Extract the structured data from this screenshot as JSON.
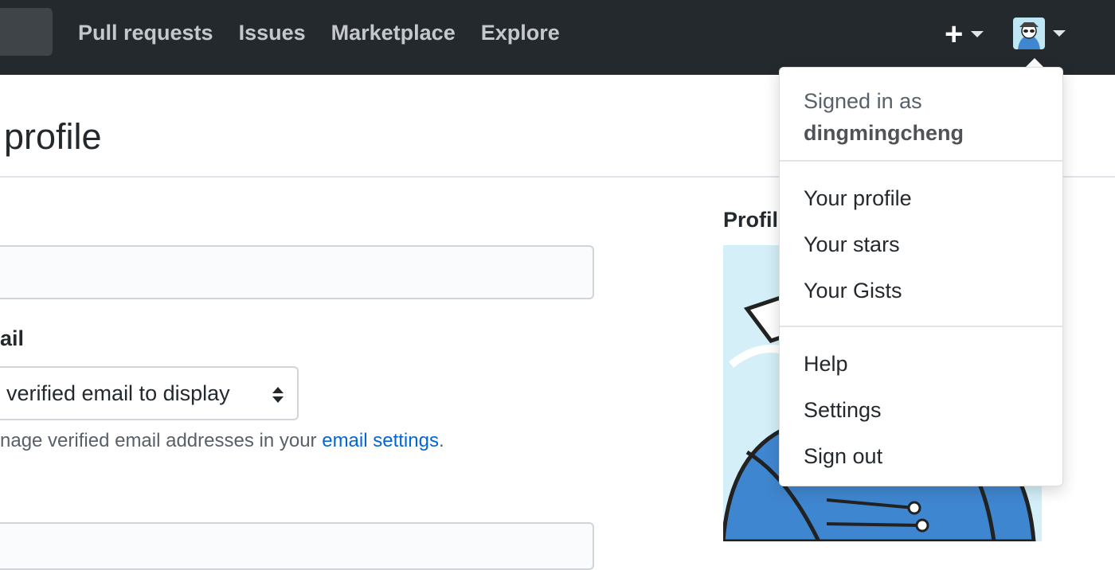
{
  "header": {
    "nav": [
      "Pull requests",
      "Issues",
      "Marketplace",
      "Explore"
    ],
    "plus_icon": "plus-icon",
    "caret_icon": "caret-down-icon"
  },
  "main": {
    "page_title": "profile",
    "email_label": "ail",
    "email_select_value": "verified email to display",
    "email_note_prefix": "nage verified email addresses in your ",
    "email_note_link": "email settings",
    "email_note_suffix": ".",
    "picture_label": "Profil"
  },
  "dropdown": {
    "signed_in_label": "Signed in as",
    "username": "dingmingcheng",
    "items_group1": [
      "Your profile",
      "Your stars",
      "Your Gists"
    ],
    "items_group2": [
      "Help",
      "Settings",
      "Sign out"
    ]
  },
  "colors": {
    "header_bg": "#24292e",
    "link": "#0366d6",
    "avatar_blue": "#3f86d0"
  }
}
